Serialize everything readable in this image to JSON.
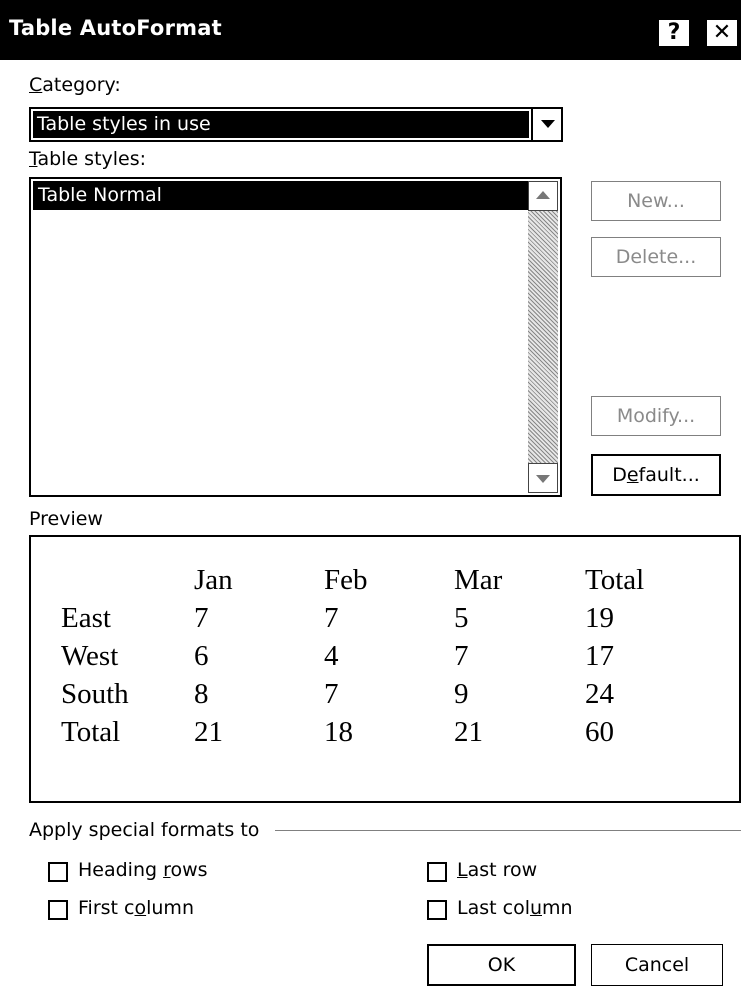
{
  "dialog": {
    "title": "Table AutoFormat",
    "help_glyph": "?",
    "close_glyph": "✕"
  },
  "category": {
    "label_accel": "C",
    "label_rest": "ategory:",
    "value": "Table styles in use"
  },
  "styles": {
    "label_accel": "T",
    "label_rest": "able styles:",
    "items": [
      "Table Normal"
    ]
  },
  "buttons": {
    "new": "New...",
    "delete": "Delete...",
    "modify": "Modify...",
    "default_pre": "D",
    "default_accel": "e",
    "default_post": "fault...",
    "ok": "OK",
    "cancel": "Cancel"
  },
  "preview": {
    "label": "Preview",
    "columns": [
      "",
      "Jan",
      "Feb",
      "Mar",
      "Total"
    ],
    "rows": [
      [
        "East",
        "7",
        "7",
        "5",
        "19"
      ],
      [
        "West",
        "6",
        "4",
        "7",
        "17"
      ],
      [
        "South",
        "8",
        "7",
        "9",
        "24"
      ],
      [
        "Total",
        "21",
        "18",
        "21",
        "60"
      ]
    ]
  },
  "special_formats": {
    "label": "Apply special formats to",
    "heading_rows": {
      "pre": "Heading ",
      "accel": "r",
      "post": "ows",
      "checked": false
    },
    "first_column": {
      "pre": "First c",
      "accel": "o",
      "post": "lumn",
      "checked": false
    },
    "last_row": {
      "pre": "",
      "accel": "L",
      "post": "ast row",
      "checked": false
    },
    "last_column": {
      "pre": "Last col",
      "accel": "u",
      "post": "mn",
      "checked": false
    }
  }
}
